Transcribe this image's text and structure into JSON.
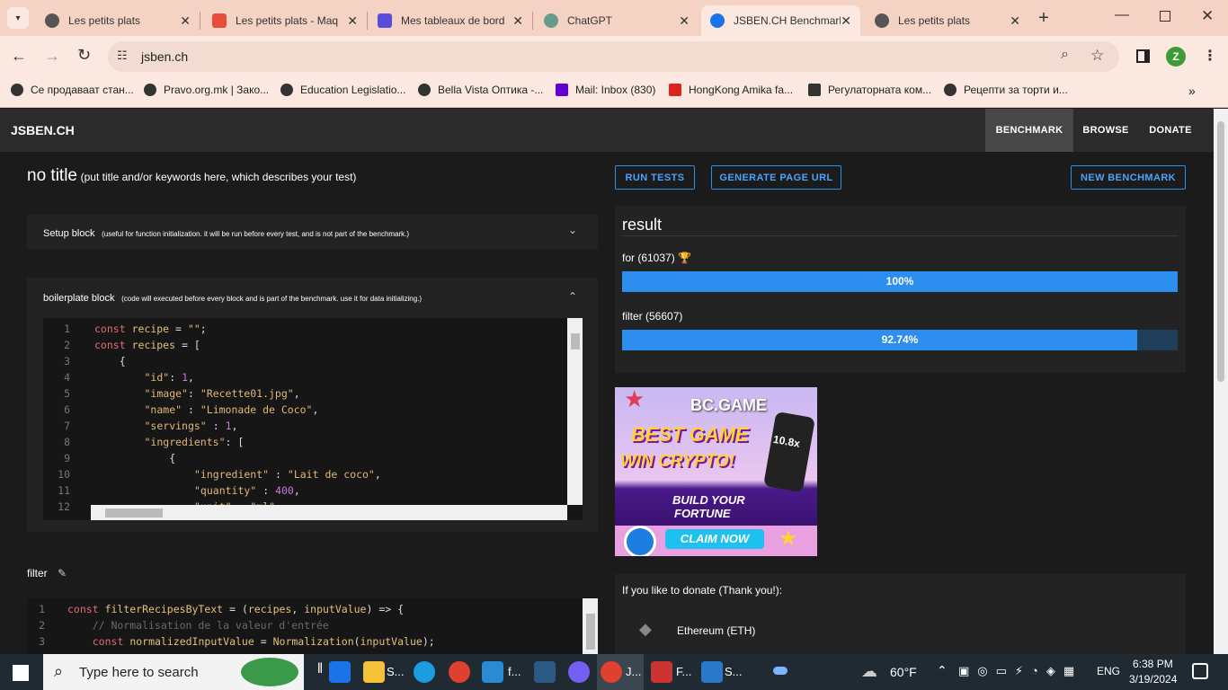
{
  "browser": {
    "tabs": [
      {
        "title": "Les petits plats",
        "color": "#555"
      },
      {
        "title": "Les petits plats - Maq",
        "color": "#e74c3c"
      },
      {
        "title": "Mes tableaux de bord",
        "color": "#5b4bdb"
      },
      {
        "title": "ChatGPT",
        "color": "#6a9a8a"
      },
      {
        "title": "JSBEN.CH Benchmark",
        "color": "#1a73e8"
      },
      {
        "title": "Les petits plats",
        "color": "#555"
      }
    ],
    "url": "jsben.ch",
    "profile_initial": "Z",
    "bookmarks": [
      "Се продаваат стан...",
      "Pravo.org.mk | Зако...",
      "Education Legislatio...",
      "Bella Vista Оптика -...",
      "Mail: Inbox (830)",
      "HongKong Amika fa...",
      "Регулаторната ком...",
      "Рецепти за торти и..."
    ]
  },
  "site": {
    "logo": "JSBEN.CH",
    "nav": [
      "BENCHMARK",
      "BROWSE",
      "DONATE"
    ],
    "title": "no title",
    "title_hint": "(put title and/or keywords here, which describes your test)",
    "buttons": {
      "run": "RUN TESTS",
      "generate": "GENERATE PAGE URL",
      "new": "NEW BENCHMARK"
    },
    "setup": {
      "label": "Setup block",
      "hint": "(useful for function initialization. it will be run before every test, and is not part of the benchmark.)"
    },
    "boilerplate": {
      "label": "boilerplate block",
      "hint": "(code will executed before every block and is part of the benchmark. use it for data initializing.)"
    },
    "filter_label": "filter",
    "result": {
      "heading": "result",
      "items": [
        {
          "name": "for (61037)",
          "percent_label": "100%",
          "fill": 1.0
        },
        {
          "name": "filter (56607)",
          "percent_label": "92.74%",
          "fill": 0.9274
        }
      ]
    },
    "ad": {
      "brand": "BC.GAME",
      "l1": "BEST GAME",
      "l2": "WIN CRYPTO!",
      "mult": "10.8x",
      "l3": "BUILD YOUR",
      "l4": "FORTUNE",
      "cta": "CLAIM NOW"
    },
    "donate": {
      "heading": "If you like to donate (Thank you!):",
      "coin": "Ethereum (ETH)"
    },
    "code1": [
      {
        "n": "1",
        "t": "const recipe = \"\";"
      },
      {
        "n": "2",
        "t": "const recipes = ["
      },
      {
        "n": "3",
        "t": "    {"
      },
      {
        "n": "4",
        "t": "        \"id\": 1,"
      },
      {
        "n": "5",
        "t": "        \"image\": \"Recette01.jpg\","
      },
      {
        "n": "6",
        "t": "        \"name\" : \"Limonade de Coco\","
      },
      {
        "n": "7",
        "t": "        \"servings\" : 1,"
      },
      {
        "n": "8",
        "t": "        \"ingredients\": ["
      },
      {
        "n": "9",
        "t": "            {"
      },
      {
        "n": "10",
        "t": "                \"ingredient\" : \"Lait de coco\","
      },
      {
        "n": "11",
        "t": "                \"quantity\" : 400,"
      },
      {
        "n": "12",
        "t": "                \"unit\" : \"ml\""
      }
    ],
    "code2": [
      {
        "n": "1",
        "t": "const filterRecipesByText = (recipes, inputValue) => {"
      },
      {
        "n": "2",
        "t": "    // Normalisation de la valeur d'entrée"
      },
      {
        "n": "3",
        "t": "    const normalizedInputValue = Normalization(inputValue);"
      }
    ]
  },
  "taskbar": {
    "search": "Type here to search",
    "weather": "60°F",
    "lang": "ENG",
    "time": "6:38 PM",
    "date": "3/19/2024",
    "apps": [
      "S...",
      "f...",
      "J...",
      "F...",
      "S..."
    ]
  }
}
